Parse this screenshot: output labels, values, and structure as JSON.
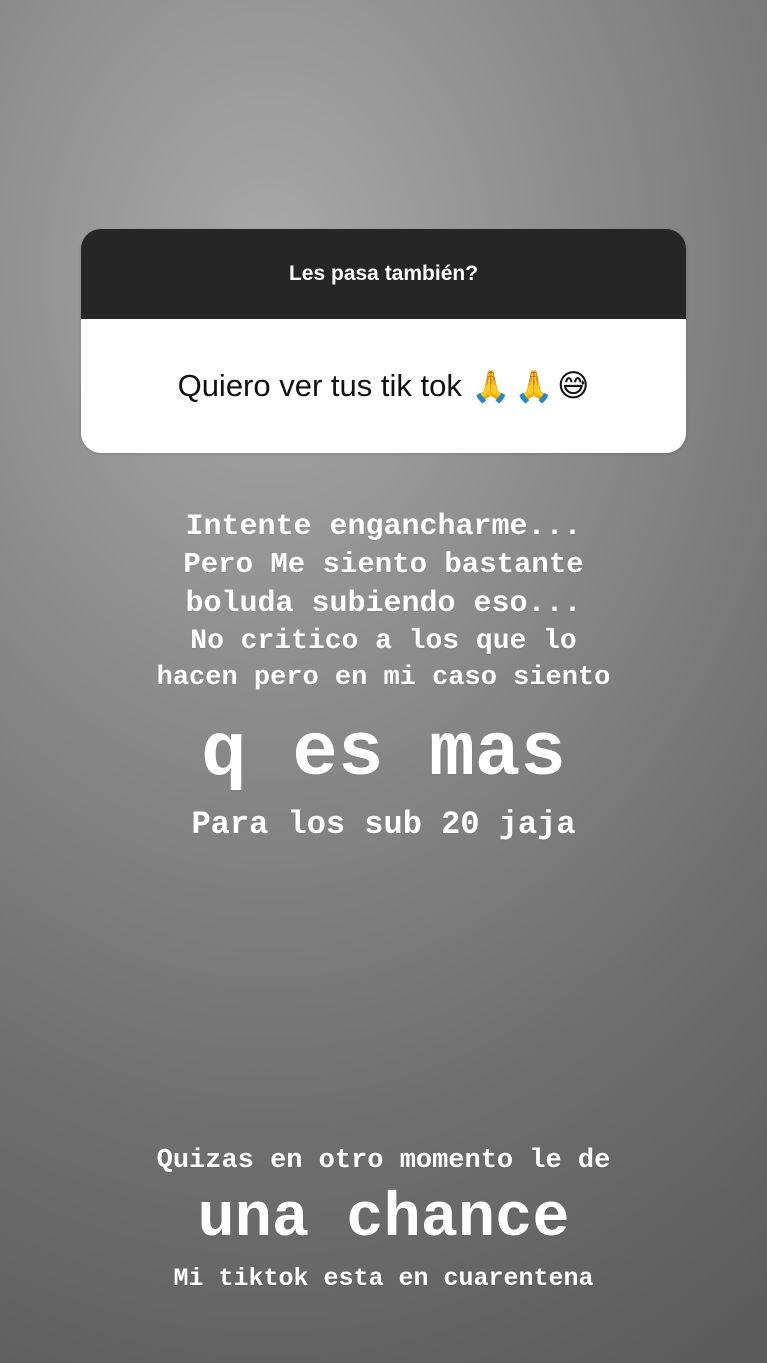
{
  "question_sticker": {
    "prompt": "Les pasa también?",
    "answer": "Quiero ver tus tik tok",
    "emojis": [
      "🙏",
      "🙏",
      "😅"
    ]
  },
  "caption": {
    "line1": "Intente engancharme...",
    "line2": "Pero Me siento bastante",
    "line3": "boluda subiendo eso...",
    "line4": "No critico a los que lo",
    "line5": "hacen pero en mi caso siento",
    "emphasis1": "q es mas",
    "line6": "Para los sub 20 jaja",
    "line7": "Quizas en otro momento le de",
    "emphasis2": "una chance",
    "line8": "Mi tiktok esta en cuarentena"
  }
}
